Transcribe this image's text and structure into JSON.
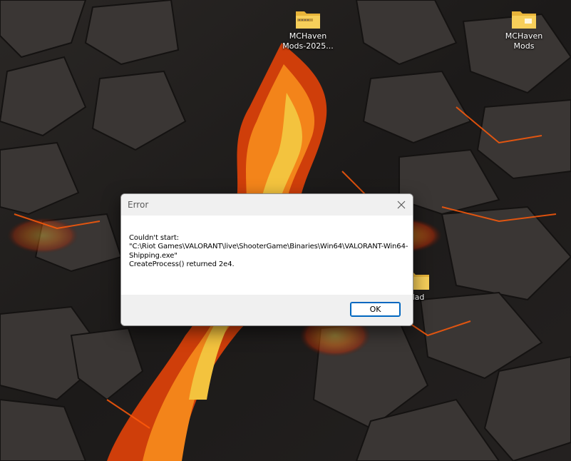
{
  "desktop": {
    "icons": [
      {
        "label": "MCHaven Mods-2025...",
        "icon": "zip-folder-icon"
      },
      {
        "label": "MCHaven Mods",
        "icon": "folder-icon"
      },
      {
        "label": "dad",
        "icon": "folder-icon"
      }
    ],
    "accent_colors": {
      "lava": "#ff6a00",
      "rock": "#2b2826"
    }
  },
  "dialog": {
    "title": "Error",
    "close_icon": "close-icon",
    "message_lines": [
      "Couldn't start:",
      "\"C:\\Riot Games\\VALORANT\\live\\ShooterGame\\Binaries\\Win64\\VALORANT-Win64-Shipping.exe\"",
      "CreateProcess() returned 2e4."
    ],
    "ok_label": "OK"
  }
}
